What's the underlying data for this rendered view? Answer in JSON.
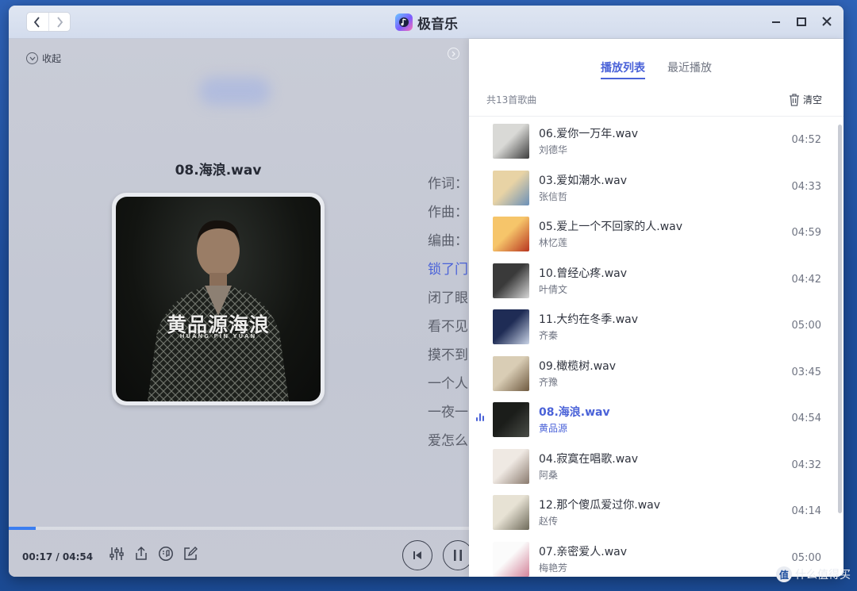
{
  "app": {
    "title": "极音乐"
  },
  "player": {
    "collapse_label": "收起",
    "song_title": "08.海浪.wav",
    "cover_text": "黄品源海浪",
    "cover_subtext": "HUANG PIN YUAN",
    "time_text": "00:17 / 04:54",
    "progress": 0.058,
    "lyrics": [
      {
        "text": "作词：",
        "active": false
      },
      {
        "text": "作曲：",
        "active": false
      },
      {
        "text": "编曲：",
        "active": false
      },
      {
        "text": "锁了门",
        "active": true
      },
      {
        "text": "闭了眼",
        "active": false
      },
      {
        "text": "看不见",
        "active": false
      },
      {
        "text": "摸不到",
        "active": false
      },
      {
        "text": "一个人",
        "active": false
      },
      {
        "text": "一夜一",
        "active": false
      },
      {
        "text": "爱怎么",
        "active": false
      }
    ]
  },
  "panel": {
    "tabs": [
      {
        "label": "播放列表",
        "active": true
      },
      {
        "label": "最近播放",
        "active": false
      }
    ],
    "count_text": "共13首歌曲",
    "clear_label": "清空",
    "songs": [
      {
        "name": "06.爱你一万年.wav",
        "artist": "刘德华",
        "duration": "04:52",
        "current": false,
        "thumb": [
          "#d9d9d6",
          "#3c3c3c"
        ]
      },
      {
        "name": "03.爱如潮水.wav",
        "artist": "张信哲",
        "duration": "04:33",
        "current": false,
        "thumb": [
          "#e8d3a5",
          "#6b90b8"
        ]
      },
      {
        "name": "05.爱上一个不回家的人.wav",
        "artist": "林忆莲",
        "duration": "04:59",
        "current": false,
        "thumb": [
          "#f6c56a",
          "#b8361f"
        ]
      },
      {
        "name": "10.曾经心疼.wav",
        "artist": "叶倩文",
        "duration": "04:42",
        "current": false,
        "thumb": [
          "#3a3a3a",
          "#d7d7d7"
        ]
      },
      {
        "name": "11.大约在冬季.wav",
        "artist": "齐秦",
        "duration": "05:00",
        "current": false,
        "thumb": [
          "#1f2c55",
          "#c9d3e6"
        ]
      },
      {
        "name": "09.橄榄树.wav",
        "artist": "齐豫",
        "duration": "03:45",
        "current": false,
        "thumb": [
          "#d9cdb5",
          "#6f5a40"
        ]
      },
      {
        "name": "08.海浪.wav",
        "artist": "黄品源",
        "duration": "04:54",
        "current": true,
        "thumb": [
          "#1b1d1a",
          "#4a4d47"
        ]
      },
      {
        "name": "04.寂寞在唱歌.wav",
        "artist": "阿桑",
        "duration": "04:32",
        "current": false,
        "thumb": [
          "#efe9e3",
          "#8a7a6e"
        ]
      },
      {
        "name": "12.那个傻瓜爱过你.wav",
        "artist": "赵传",
        "duration": "04:14",
        "current": false,
        "thumb": [
          "#e7e2d4",
          "#6e6a5a"
        ]
      },
      {
        "name": "07.亲密爱人.wav",
        "artist": "梅艳芳",
        "duration": "05:00",
        "current": false,
        "thumb": [
          "#fbfbfb",
          "#d4849a"
        ]
      }
    ]
  },
  "watermark": {
    "text": "什么值得买",
    "icon": "值"
  },
  "colors": {
    "accent": "#4a62d8",
    "progress": "#3c7ef0",
    "desktop": "#2256a8"
  }
}
